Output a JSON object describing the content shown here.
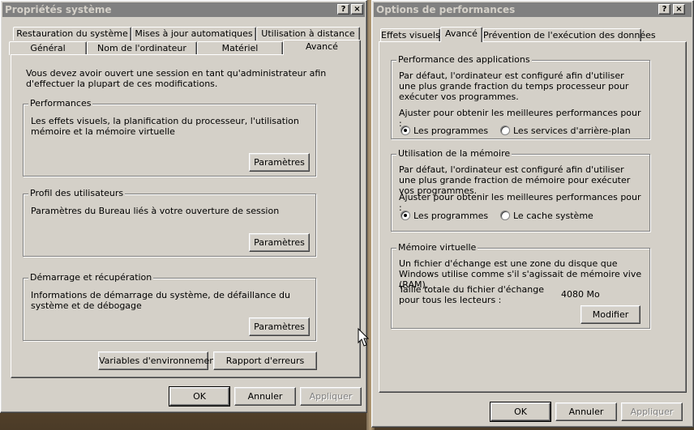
{
  "left_window": {
    "title": "Propriétés système",
    "title_buttons": [
      "?",
      "×"
    ],
    "tabs_row1": [
      "Restauration du système",
      "Mises à jour automatiques",
      "Utilisation à distance"
    ],
    "tabs_row2": [
      "Général",
      "Nom de l'ordinateur",
      "Matériel",
      "Avancé"
    ],
    "active_tab": "Avancé",
    "intro": "Vous devez avoir ouvert une session en tant qu'administrateur afin d'effectuer la plupart de ces modifications.",
    "groups": [
      {
        "legend": "Performances",
        "text": "Les effets visuels, la planification du processeur, l'utilisation mémoire et la mémoire virtuelle",
        "button": "Paramètres"
      },
      {
        "legend": "Profil des utilisateurs",
        "text": "Paramètres du Bureau liés à votre ouverture de session",
        "button": "Paramètres"
      },
      {
        "legend": "Démarrage et récupération",
        "text": "Informations de démarrage du système, de défaillance du système et de débogage",
        "button": "Paramètres"
      }
    ],
    "env_button": "Variables d'environnement",
    "error_button": "Rapport d'erreurs",
    "ok": "OK",
    "cancel": "Annuler",
    "apply": "Appliquer"
  },
  "right_window": {
    "title": "Options de performances",
    "title_buttons": [
      "?",
      "×"
    ],
    "tabs": [
      "Effets visuels",
      "Avancé",
      "Prévention de l'exécution des données"
    ],
    "active_tab": "Avancé",
    "app_perf": {
      "legend": "Performance des applications",
      "text": "Par défaut, l'ordinateur est configuré afin d'utiliser une plus grande fraction du temps processeur pour exécuter vos programmes.",
      "adjust": "Ajuster pour obtenir les meilleures performances pour :",
      "option1": "Les programmes",
      "option2": "Les services d'arrière-plan",
      "selected": "Les programmes"
    },
    "memory": {
      "legend": "Utilisation de la mémoire",
      "text": "Par défaut, l'ordinateur est configuré afin d'utiliser une plus grande fraction de mémoire pour exécuter vos programmes.",
      "adjust": "Ajuster pour obtenir les meilleures performances pour :",
      "option1": "Les programmes",
      "option2": "Le cache système",
      "selected": "Les programmes"
    },
    "virtual_memory": {
      "legend": "Mémoire virtuelle",
      "text": "Un fichier d'échange est une zone du disque que Windows utilise comme s'il s'agissait de mémoire vive (RAM).",
      "size_label": "Taille totale du fichier d'échange pour tous les lecteurs :",
      "size_value": "4080 Mo",
      "button": "Modifier"
    },
    "ok": "OK",
    "cancel": "Annuler",
    "apply": "Appliquer"
  },
  "colors": {
    "face": "#d4d0c8",
    "inactive_title": "#808080",
    "inactive_title_text": "#d4d0c8"
  }
}
